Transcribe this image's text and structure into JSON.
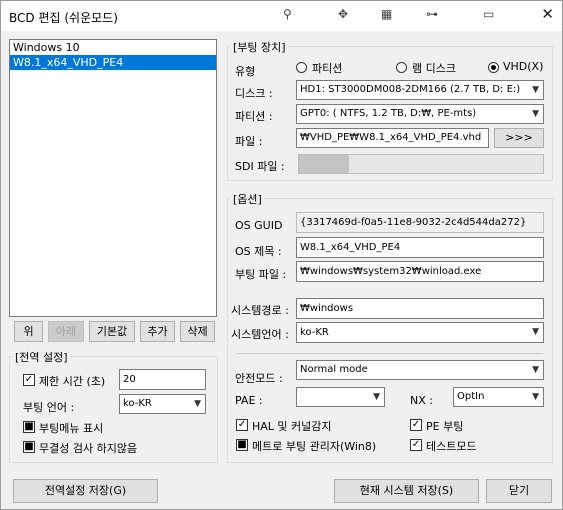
{
  "window": {
    "title": "BCD 편집 (쉬운모드)"
  },
  "entries": [
    "Windows 10",
    "W8.1_x64_VHD_PE4"
  ],
  "entry_buttons": {
    "up": "위",
    "down": "아래",
    "default": "기본값",
    "add": "추가",
    "delete": "삭제"
  },
  "global": {
    "legend": "[전역 설정]",
    "timeout_label": "제한 시간 (초)",
    "timeout_value": "20",
    "timeout_checked": true,
    "language_label": "부팅 언어 :",
    "language_value": "ko-KR",
    "show_menu_label": "부팅메뉴 표시",
    "show_menu_checked": true,
    "no_integrity_label": "무결성 검사 하지않음",
    "no_integrity_checked": true
  },
  "boot_device": {
    "legend": "[부팅 장치]",
    "type_label": "유형",
    "type_partition": "파티션",
    "type_ramdisk": "램 디스크",
    "type_vhd": "VHD(X)",
    "selected_type": "vhd",
    "disk_label": "디스크 :",
    "disk_value": "HD1: ST3000DM008-2DM166 (2.7 TB, D: E:)",
    "partition_label": "파티션 :",
    "partition_value": "GPT0: ( NTFS,   1.2 TB, D:₩, PE-mts)",
    "file_label": "파일 :",
    "file_value": "₩VHD_PE₩W8.1_x64_VHD_PE4.vhd",
    "browse_label": ">>>",
    "sdi_label": "SDI 파일 :"
  },
  "options": {
    "legend": "[옵션]",
    "guid_label": "OS GUID",
    "guid_value": "{3317469d-f0a5-11e8-9032-2c4d544da272}",
    "name_label": "OS 제목 :",
    "name_value": "W8.1_x64_VHD_PE4",
    "bootfile_label": "부팅 파일 :",
    "bootfile_value": "₩windows₩system32₩winload.exe",
    "syspath_label": "시스템경로 :",
    "syspath_value": "₩windows",
    "syslang_label": "시스템언어 :",
    "syslang_value": "ko-KR",
    "safemode_label": "안전모드 :",
    "safemode_value": "Normal mode",
    "pae_label": "PAE :",
    "pae_value": "",
    "nx_label": "NX :",
    "nx_value": "OptIn",
    "hal_label": "HAL 및 커널감지",
    "hal_checked": true,
    "pe_label": "PE 부팅",
    "pe_checked": true,
    "metro_label": "메트로 부팅 관리자(Win8)",
    "metro_checked": true,
    "testmode_label": "테스트모드",
    "testmode_checked": true
  },
  "footer": {
    "save_global": "전역설정 저장(G)",
    "save_current": "현재 시스템 저장(S)",
    "close": "닫기"
  }
}
